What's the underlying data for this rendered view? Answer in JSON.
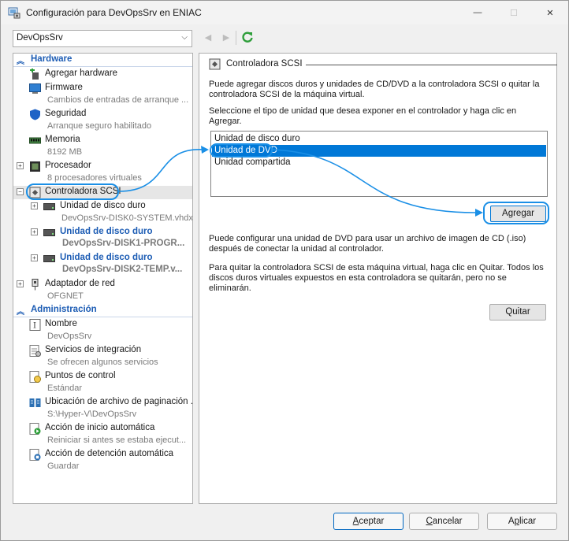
{
  "window": {
    "title": "Configuración para DevOpsSrv en ENIAC",
    "minimize": "—",
    "maximize": "☐",
    "close": "✕"
  },
  "toolbar": {
    "vm_selected": "DevOpsSrv",
    "back": "◀",
    "forward": "▶"
  },
  "tree": {
    "hardware": {
      "header": "Hardware",
      "items": [
        {
          "label": "Agregar hardware",
          "sub": ""
        },
        {
          "label": "Firmware",
          "sub": "Cambios de entradas de arranque ..."
        },
        {
          "label": "Seguridad",
          "sub": "Arranque seguro habilitado"
        },
        {
          "label": "Memoria",
          "sub": "8192 MB"
        },
        {
          "label": "Procesador",
          "sub": "8 procesadores virtuales"
        },
        {
          "label": "Controladora SCSI",
          "sub": ""
        },
        {
          "label": "Unidad de disco duro",
          "sub": "DevOpsSrv-DISK0-SYSTEM.vhdx"
        },
        {
          "label": "Unidad de disco duro",
          "sub": "DevOpsSrv-DISK1-PROGR..."
        },
        {
          "label": "Unidad de disco duro",
          "sub": "DevOpsSrv-DISK2-TEMP.v..."
        },
        {
          "label": "Adaptador de red",
          "sub": "OFGNET"
        }
      ]
    },
    "management": {
      "header": "Administración",
      "items": [
        {
          "label": "Nombre",
          "sub": "DevOpsSrv"
        },
        {
          "label": "Servicios de integración",
          "sub": "Se ofrecen algunos servicios"
        },
        {
          "label": "Puntos de control",
          "sub": "Estándar"
        },
        {
          "label": "Ubicación de archivo de paginación ...",
          "sub": "S:\\Hyper-V\\DevOpsSrv"
        },
        {
          "label": "Acción de inicio automática",
          "sub": "Reiniciar si antes se estaba ejecut..."
        },
        {
          "label": "Acción de detención automática",
          "sub": "Guardar"
        }
      ]
    }
  },
  "panel": {
    "title": "Controladora SCSI",
    "intro": "Puede agregar discos duros y unidades de CD/DVD a la controladora SCSI o quitar la controladora SCSI de la máquina virtual.",
    "select_prompt": "Seleccione el tipo de unidad que desea exponer en el controlador y haga clic en Agregar.",
    "drive_types": [
      "Unidad de disco duro",
      "Unidad de DVD",
      "Unidad compartida"
    ],
    "selected_index": 1,
    "add_button": "Agregar",
    "dvd_info": "Puede configurar una unidad de DVD para usar un archivo de imagen de CD (.iso) después de conectar la unidad al controlador.",
    "remove_info": "Para quitar la controladora SCSI de esta máquina virtual, haga clic en Quitar. Todos los discos duros virtuales expuestos en esta controladora se quitarán, pero no se eliminarán.",
    "remove_button": "Quitar"
  },
  "footer": {
    "ok": "Aceptar",
    "cancel": "Cancelar",
    "apply": "Aplicar"
  },
  "colors": {
    "accent": "#0078d7",
    "section_header": "#1c5cb4",
    "annotation": "#1a8fe6"
  }
}
